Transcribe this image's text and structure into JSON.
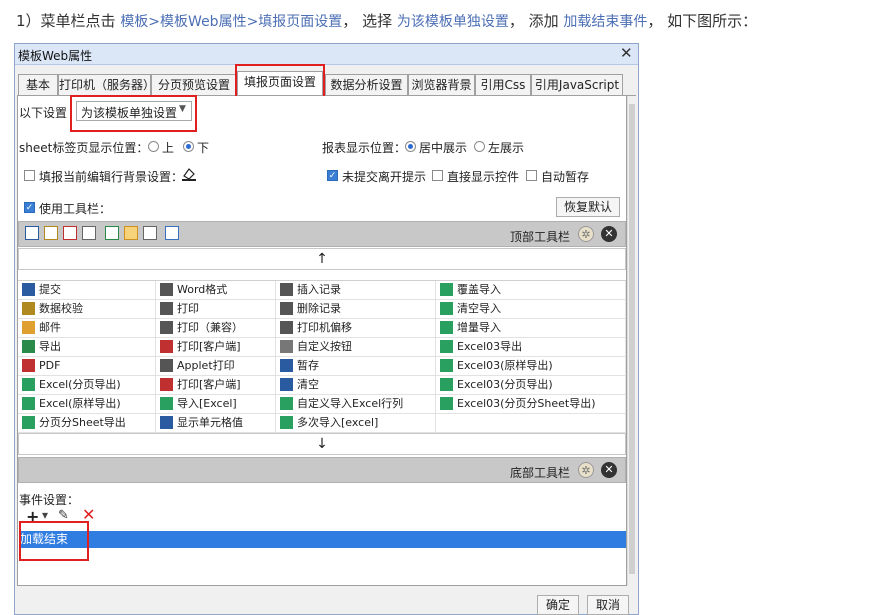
{
  "instruction": {
    "p1": "1）菜单栏点击 ",
    "p2": "模板>模板Web属性>填报页面设置",
    "p3": "， 选择 ",
    "p4": "为该模板单独设置",
    "p5": "， 添加 ",
    "p6": "加载结束事件",
    "p7": "， 如下图所示："
  },
  "dialog": {
    "title": "模板Web属性",
    "close": "✕",
    "tabs": [
      "基本",
      "打印机（服务器）",
      "分页预览设置",
      "填报页面设置",
      "数据分析设置",
      "浏览器背景",
      "引用Css",
      "引用JavaScript"
    ],
    "active_tab": "填报页面设置",
    "setting_label": "以下设置",
    "setting_value": "为该模板单独设置",
    "sheet_label": "sheet标签页显示位置：",
    "sheet_opt_top": "上",
    "sheet_opt_bottom": "下",
    "report_label": "报表显示位置：",
    "report_opt_center": "居中展示",
    "report_opt_left": "左展示",
    "fill_bg_label": "填报当前编辑行背景设置：",
    "unsubmitted_label": "未提交离开提示",
    "direct_show_label": "直接显示控件",
    "autosave_label": "自动暂存",
    "use_toolbar_label": "使用工具栏：",
    "restore_default": "恢复默认",
    "top_toolbar_label": "顶部工具栏",
    "bottom_toolbar_label": "底部工具栏",
    "arrow_up": "↑",
    "arrow_down": "↓",
    "event_label": "事件设置：",
    "event_item": "加载结束",
    "ok": "确定",
    "cancel": "取消"
  },
  "toolbar_grid": [
    [
      "提交",
      "Word格式",
      "插入记录",
      "覆盖导入"
    ],
    [
      "数据校验",
      "打印",
      "删除记录",
      "清空导入"
    ],
    [
      "邮件",
      "打印（兼容）",
      "打印机偏移",
      "增量导入"
    ],
    [
      "导出",
      "打印[客户端]",
      "自定义按钮",
      "Excel03导出"
    ],
    [
      "PDF",
      "Applet打印",
      "暂存",
      "Excel03(原样导出)"
    ],
    [
      "Excel(分页导出)",
      "打印[客户端]",
      "清空",
      "Excel03(分页导出)"
    ],
    [
      "Excel(原样导出)",
      "导入[Excel]",
      "自定义导入Excel行列",
      "Excel03(分页分Sheet导出)"
    ],
    [
      "分页分Sheet导出",
      "显示单元格值",
      "多次导入[excel]",
      ""
    ]
  ],
  "icons": {
    "accent": "#3a7fd5",
    "selection": "#2f7de1",
    "highlight_box": "#e02020"
  }
}
